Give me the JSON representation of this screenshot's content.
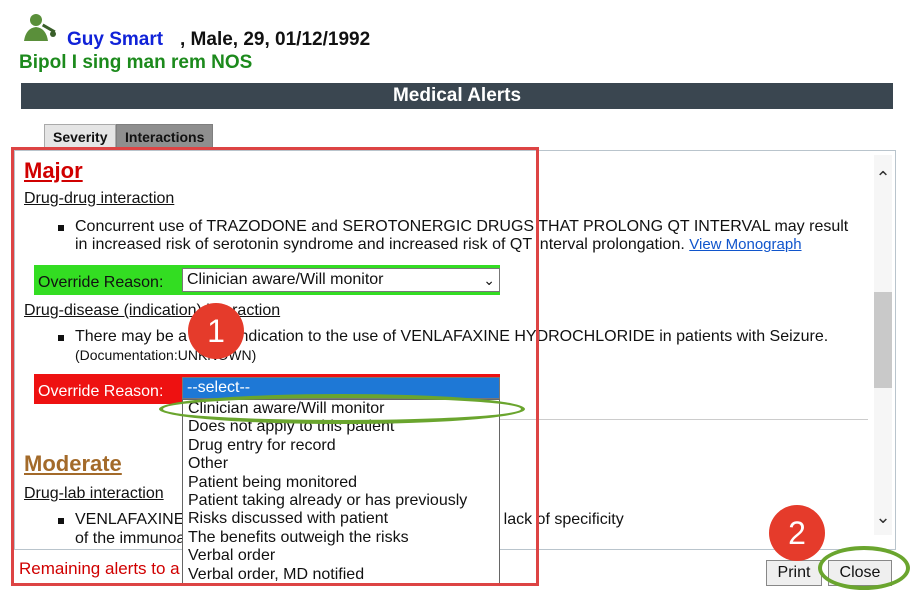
{
  "patient": {
    "name": "Guy Smart",
    "demographics": ", Male, 29, 01/12/1992",
    "diagnosis": "Bipol I sing man rem NOS",
    "avatar_icon": "patient-doctor-icon"
  },
  "window": {
    "title": "Medical Alerts"
  },
  "tabs": [
    {
      "label": "Severity",
      "active": true
    },
    {
      "label": "Interactions",
      "active": false
    }
  ],
  "sections": {
    "major": {
      "title": "Major",
      "drug_drug": {
        "category": "Drug-drug interaction",
        "line1": "Concurrent use of TRAZODONE and SEROTONERGIC DRUGS THAT PROLONG QT INTERVAL may result",
        "line2": "in increased risk of serotonin syndrome and increased risk of QT interval prolongation.",
        "link": "View Monograph",
        "override_label": "Override Reason:",
        "override_value": "Clinician aware/Will monitor"
      },
      "drug_disease": {
        "category": "Drug-disease (indication) interaction",
        "line1": "There may be a contraindication to the use of VENLAFAXINE HYDROCHLORIDE in patients with Seizure.",
        "line2": "(Documentation:UNKNOWN)",
        "override_label": "Override Reason:",
        "override_value": "--select--"
      }
    },
    "moderate": {
      "title": "Moderate",
      "drug_lab": {
        "category": "Drug-lab interaction",
        "line1": "VENLAFAXINE ... phencyclidine immunoassay result due to lack of specificity",
        "line2": "of the immunoa"
      }
    }
  },
  "dropdown_options": [
    "Clinician aware/Will monitor",
    "Does not apply to this patient",
    "Drug entry for record",
    "Other",
    "Patient being monitored",
    "Patient taking already or has previously",
    "Risks discussed with patient",
    "The benefits outweigh the risks",
    "Verbal order",
    "Verbal order, MD notified"
  ],
  "footer": {
    "remaining": "Remaining alerts to a",
    "print_label": "Print",
    "close_label": "Close"
  },
  "annotations": {
    "badge1": "1",
    "badge2": "2",
    "highlight_color": "#6aa52e",
    "box_color": "#dd4444"
  }
}
